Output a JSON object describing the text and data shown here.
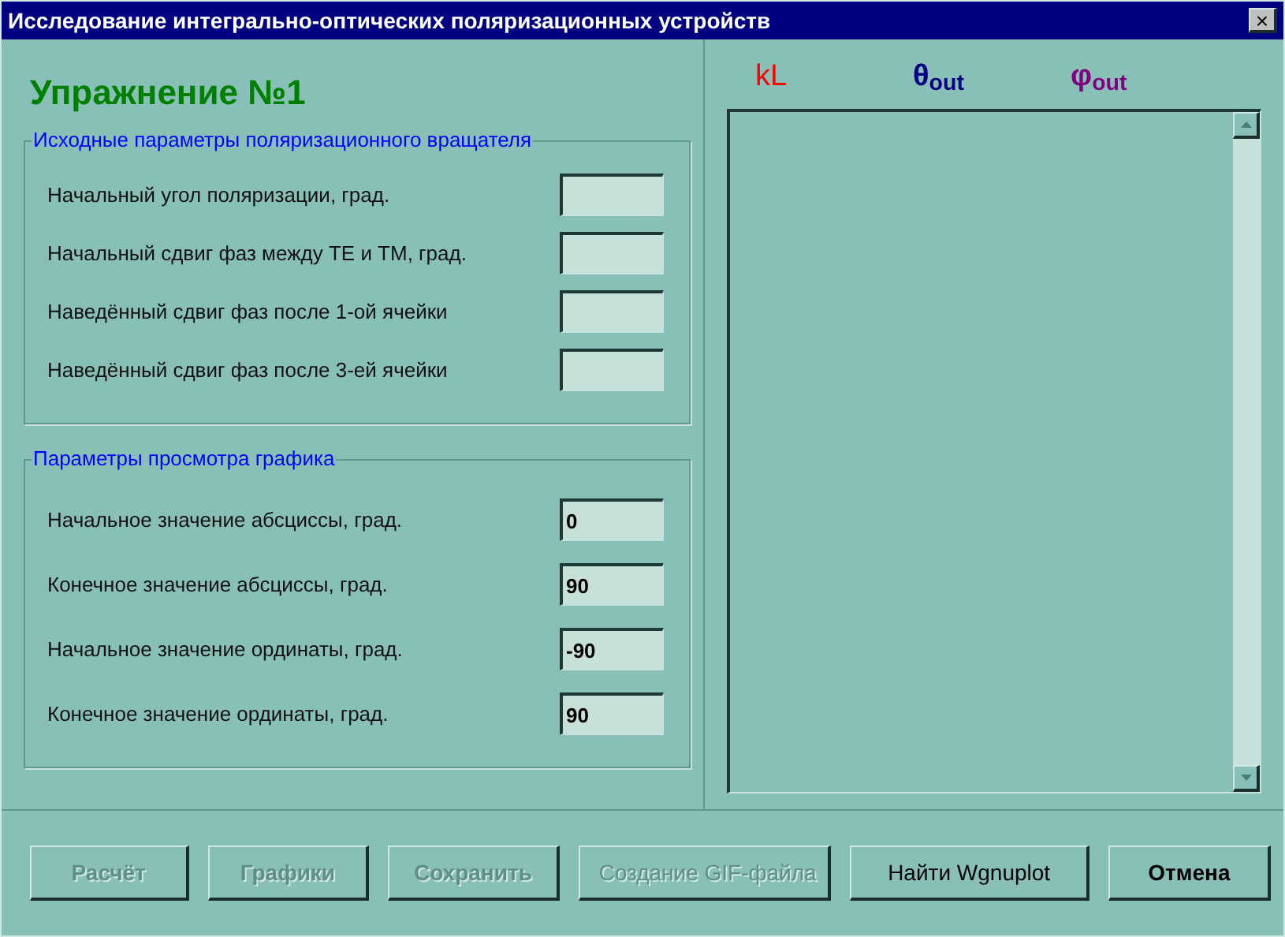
{
  "window": {
    "title": "Исследование интегрально-оптических поляризационных устройств",
    "close": "×"
  },
  "heading": "Упражнение №1",
  "groups": [
    {
      "title": "Исходные параметры поляризационного вращателя",
      "fields": [
        {
          "label": "Начальный угол поляризации, град."
        },
        {
          "label": "Начальный сдвиг фаз между ТЕ и ТМ, град."
        },
        {
          "label": "Наведённый сдвиг фаз после 1-ой ячейки"
        },
        {
          "label": "Наведённый сдвиг фаз после 3-ей ячейки"
        }
      ]
    },
    {
      "title": "Параметры просмотра графика",
      "fields": [
        {
          "label": "Начальное значение абсциссы, град.",
          "value": "0"
        },
        {
          "label": "Конечное значение абсциссы, град.",
          "value": "90"
        },
        {
          "label": "Начальное значение ординаты, град.",
          "value": "-90"
        },
        {
          "label": "Конечное значение ординаты, град.",
          "value": "90"
        }
      ]
    }
  ],
  "columns": [
    {
      "label": "kL",
      "color": "#ff0000"
    },
    {
      "label": "θ$_{out}$",
      "color": "#000080"
    },
    {
      "label": "φ$_{out}$",
      "color": "#800080"
    }
  ],
  "buttons": [
    {
      "label": "Расчёт",
      "disabled": true,
      "bold": true
    },
    {
      "label": "Графики",
      "disabled": true,
      "bold": true
    },
    {
      "label": "Сохранить",
      "disabled": true,
      "bold": true
    },
    {
      "label": "Создание GIF-файла",
      "disabled": true,
      "bold": false
    },
    {
      "label": "Найти Wgnuplot",
      "disabled": false,
      "bold": false
    },
    {
      "label": "Отмена",
      "disabled": false,
      "bold": true
    }
  ]
}
